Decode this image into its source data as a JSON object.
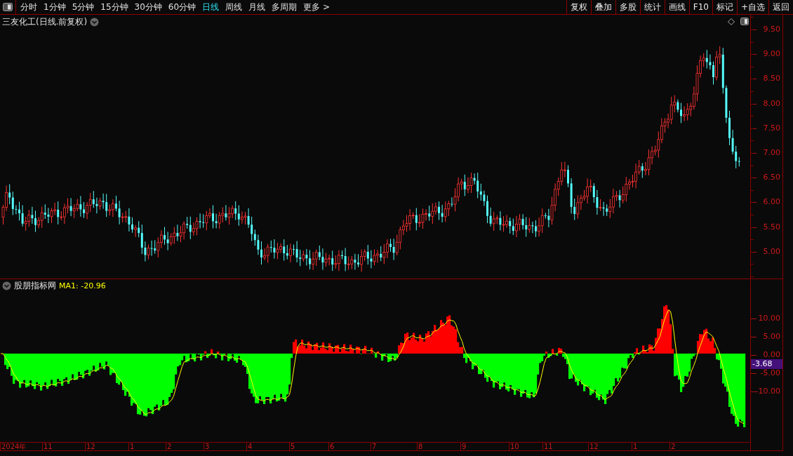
{
  "toolbar": {
    "periods": [
      {
        "label": "分时",
        "selected": false
      },
      {
        "label": "1分钟",
        "selected": false
      },
      {
        "label": "5分钟",
        "selected": false
      },
      {
        "label": "15分钟",
        "selected": false
      },
      {
        "label": "30分钟",
        "selected": false
      },
      {
        "label": "60分钟",
        "selected": false
      },
      {
        "label": "日线",
        "selected": true
      },
      {
        "label": "周线",
        "selected": false
      },
      {
        "label": "月线",
        "selected": false
      },
      {
        "label": "多周期",
        "selected": false
      },
      {
        "label": "更多 >",
        "selected": false
      }
    ],
    "buttons": [
      "复权",
      "叠加",
      "多股",
      "统计",
      "画线",
      "F10",
      "标记",
      "+自选",
      "返回"
    ]
  },
  "price_pane": {
    "title": "三友化工(日线.前复权)",
    "axis_labels": [
      "9.50",
      "9.00",
      "8.50",
      "8.00",
      "7.50",
      "7.00",
      "6.50",
      "6.00",
      "5.50",
      "5.00"
    ]
  },
  "indicator_pane": {
    "title": "股朋指标网",
    "ma_reading": "MA1: -20.96",
    "axis_labels": [
      "10.00",
      "5.00",
      "0.00",
      "-5.00",
      "-10.00"
    ],
    "current_value": "-3.68"
  },
  "time_axis": {
    "labels": [
      "2024年",
      "11",
      "12",
      "1",
      "2",
      "3",
      "4",
      "5",
      "6",
      "7",
      "8",
      "9",
      "10",
      "11",
      "12",
      "1",
      "2"
    ]
  }
}
